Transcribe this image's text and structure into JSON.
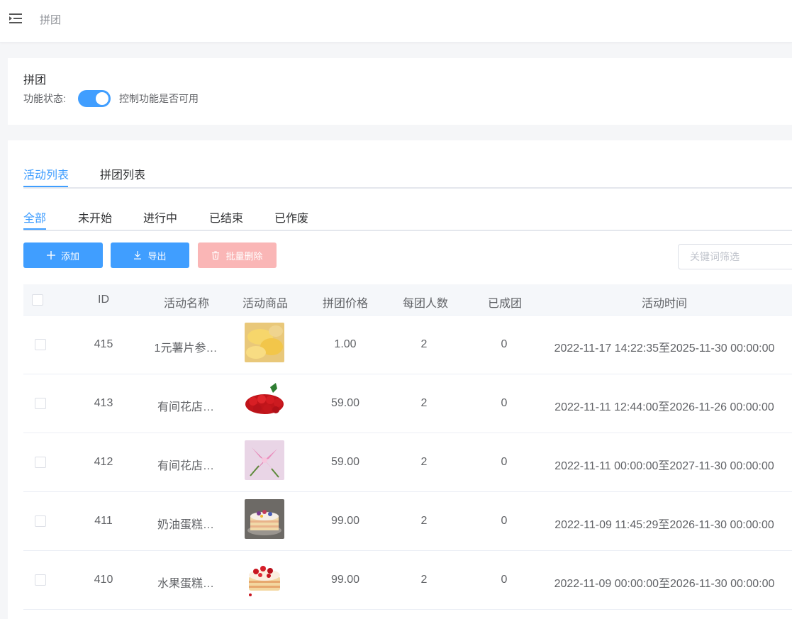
{
  "header": {
    "title": "拼团"
  },
  "feature": {
    "title": "拼团",
    "status_label": "功能状态:",
    "enabled": true,
    "status_desc": "控制功能是否可用"
  },
  "tabs": [
    {
      "label": "活动列表",
      "active": true
    },
    {
      "label": "拼团列表",
      "active": false
    }
  ],
  "subtabs": [
    {
      "label": "全部",
      "active": true
    },
    {
      "label": "未开始",
      "active": false
    },
    {
      "label": "进行中",
      "active": false
    },
    {
      "label": "已结束",
      "active": false
    },
    {
      "label": "已作废",
      "active": false
    }
  ],
  "toolbar": {
    "add_label": "添加",
    "export_label": "导出",
    "batch_delete_label": "批量删除",
    "search_placeholder": "关键词筛选"
  },
  "table": {
    "columns": [
      "ID",
      "活动名称",
      "活动商品",
      "拼团价格",
      "每团人数",
      "已成团",
      "活动时间"
    ],
    "rows": [
      {
        "id": "415",
        "name": "1元薯片参…",
        "product_image": "potato-chips",
        "price": "1.00",
        "size": "2",
        "formed": "0",
        "time": "2022-11-17 14:22:35至2025-11-30 00:00:00"
      },
      {
        "id": "413",
        "name": "有间花店…",
        "product_image": "red-roses",
        "price": "59.00",
        "size": "2",
        "formed": "0",
        "time": "2022-11-11 12:44:00至2026-11-26 00:00:00"
      },
      {
        "id": "412",
        "name": "有间花店…",
        "product_image": "pink-lilies",
        "price": "59.00",
        "size": "2",
        "formed": "0",
        "time": "2022-11-11 00:00:00至2027-11-30 00:00:00"
      },
      {
        "id": "411",
        "name": "奶油蛋糕…",
        "product_image": "cream-cake",
        "price": "99.00",
        "size": "2",
        "formed": "0",
        "time": "2022-11-09 11:45:29至2026-11-30 00:00:00"
      },
      {
        "id": "410",
        "name": "水果蛋糕…",
        "product_image": "fruit-cake",
        "price": "99.00",
        "size": "2",
        "formed": "0",
        "time": "2022-11-09 00:00:00至2026-11-30 00:00:00"
      }
    ]
  },
  "colors": {
    "primary": "#409eff",
    "danger_disabled": "#fab6b6",
    "text": "#606266"
  }
}
